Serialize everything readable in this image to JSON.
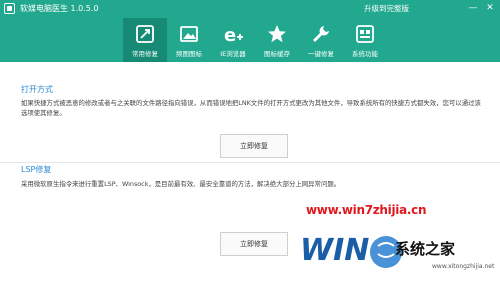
{
  "app": {
    "title": "软媒电脑医生 1.0.5.0",
    "upgrade_link": "升级到完整版",
    "window_controls": {
      "minimize": "—",
      "close": "✕"
    }
  },
  "toolbar": {
    "items": [
      {
        "label": "常用修复",
        "icon": "repair-icon",
        "active": true
      },
      {
        "label": "频图图标",
        "icon": "image-icon",
        "active": false
      },
      {
        "label": "IE浏览器",
        "icon": "ie-icon",
        "active": false
      },
      {
        "label": "图标缓存",
        "icon": "star-icon",
        "active": false
      },
      {
        "label": "一键修复",
        "icon": "wrench-icon",
        "active": false
      },
      {
        "label": "系统功能",
        "icon": "gear-icon",
        "active": false
      }
    ]
  },
  "sections": [
    {
      "title": "打开方式",
      "description": "如果快捷方式被恶意的修改或者与之关联的文件路径指向错误，从而错误地把LNK文件的打开方式更改为其他文件，导致系统所有的快捷方式都失效，您可以通过该选项使其修复。",
      "button_label": "立即修复"
    },
    {
      "title": "LSP修复",
      "description": "采用微软原生指令来进行重置LSP、Winsock，是目前最有效、最安全靠谱的方法，解决绝大部分上网异常问题。",
      "button_label": "立即修复"
    }
  ],
  "watermark": {
    "url": "www.win7zhijia.cn",
    "site_name": "系统之家",
    "site_url": "www.xitongzhijia.net"
  },
  "colors": {
    "header": "#21a88e",
    "active_tab": "#168a74",
    "section_title": "#2c8bd6",
    "watermark_red": "#e0191f"
  }
}
